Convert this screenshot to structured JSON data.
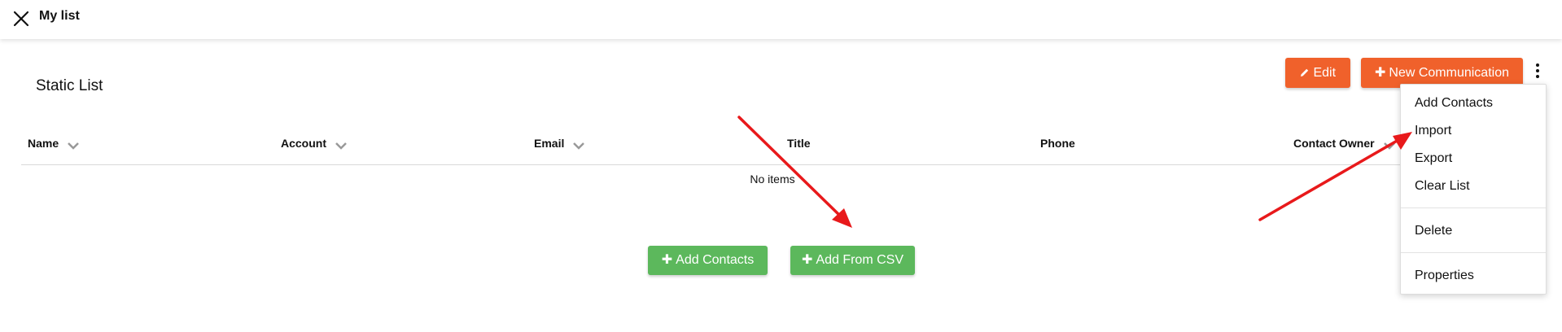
{
  "header": {
    "title": "My list"
  },
  "page": {
    "title": "Static List"
  },
  "toolbar": {
    "edit_label": "Edit",
    "new_communication_label": "New Communication"
  },
  "table": {
    "columns": [
      {
        "label": "Name",
        "sortable": true
      },
      {
        "label": "Account",
        "sortable": true
      },
      {
        "label": "Email",
        "sortable": true
      },
      {
        "label": "Title",
        "sortable": false
      },
      {
        "label": "Phone",
        "sortable": false
      },
      {
        "label": "Contact Owner",
        "sortable": true
      }
    ],
    "empty_message": "No items"
  },
  "actions": {
    "add_contacts_label": "Add Contacts",
    "add_from_csv_label": "Add From CSV"
  },
  "menu": {
    "items": [
      "Add Contacts",
      "Import",
      "Export",
      "Clear List",
      "Delete",
      "Properties"
    ]
  },
  "colors": {
    "accent_orange": "#f0612b",
    "accent_green": "#5cb85c",
    "annotation_red": "#e8191b"
  }
}
